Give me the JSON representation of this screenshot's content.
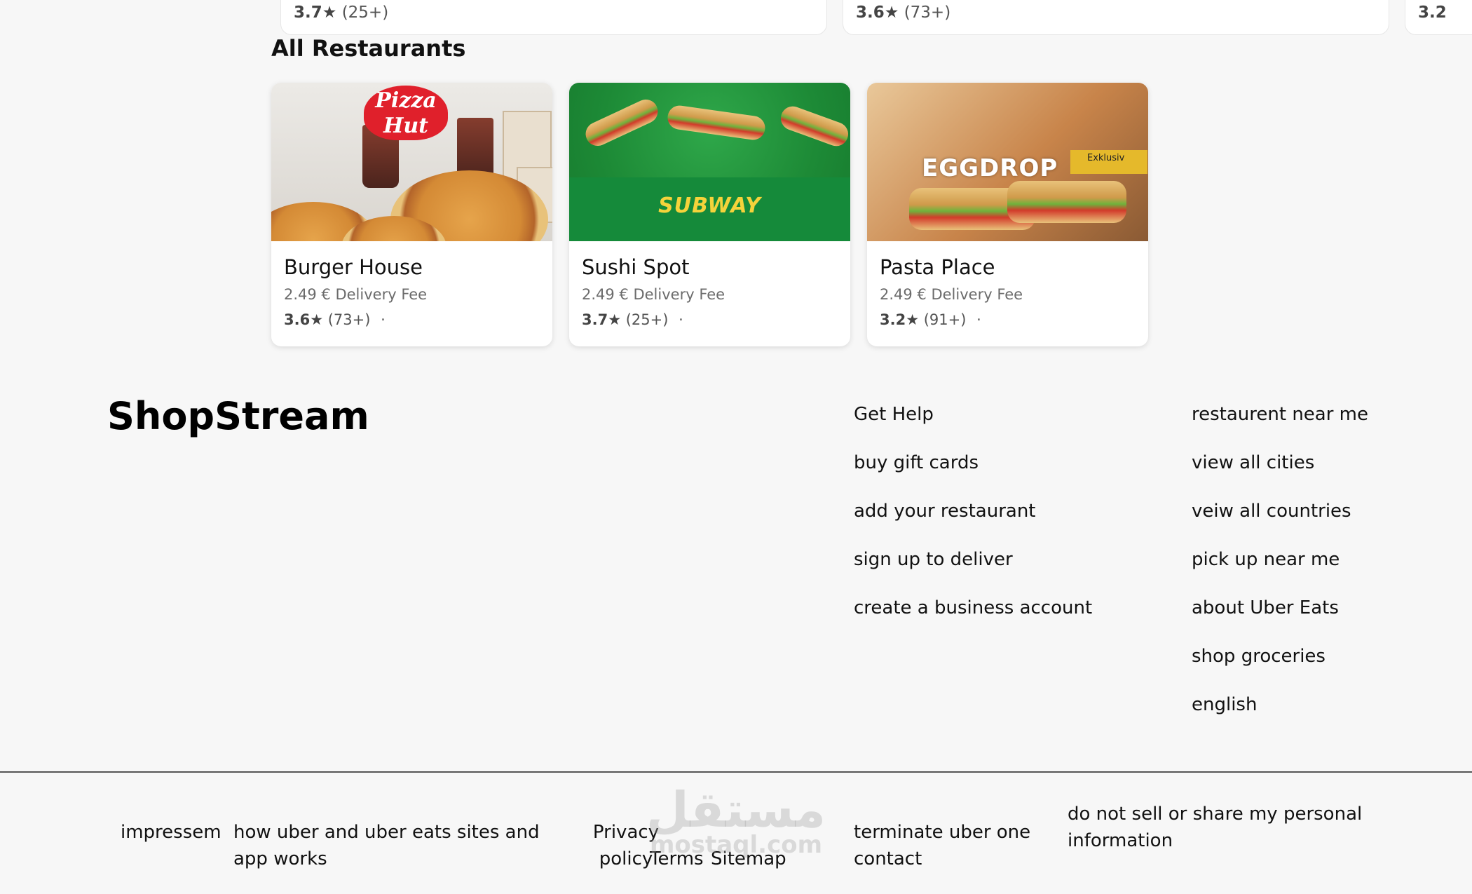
{
  "top_carousel": [
    {
      "rating": "3.7★",
      "count": "(25+)"
    },
    {
      "rating": "3.6★",
      "count": "(73+)"
    },
    {
      "rating": "3.2"
    }
  ],
  "section_title": "All Restaurants",
  "restaurants": [
    {
      "name": "Burger House",
      "fee": "2.49 € Delivery Fee",
      "rating": "3.6★",
      "count": "(73+)",
      "dot": "·",
      "image_logo": "Pizza Hut"
    },
    {
      "name": "Sushi Spot",
      "fee": "2.49 € Delivery Fee",
      "rating": "3.7★",
      "count": "(25+)",
      "dot": "·",
      "image_logo": "SUBWAY"
    },
    {
      "name": "Pasta Place",
      "fee": "2.49 € Delivery Fee",
      "rating": "3.2★",
      "count": "(91+)",
      "dot": "·",
      "image_logo": "EGGDROP",
      "image_badge": "Exklusiv"
    }
  ],
  "footer": {
    "brand": "ShopStream",
    "col1": [
      "Get Help",
      "buy gift cards",
      "add your restaurant",
      "sign up to deliver",
      "create a business account"
    ],
    "col2": [
      "restaurent near me",
      "view all cities",
      "veiw all countries",
      "pick up near me",
      "about Uber Eats",
      "shop groceries",
      "english"
    ]
  },
  "bottom_links": {
    "impressem": "impressem",
    "how_it_works": "how uber and uber eats sites and app works",
    "privacy": "Privacy policy",
    "terms": "Terms",
    "sitemap": "Sitemap",
    "terminate": "terminate uber one",
    "contact": "contact",
    "do_not_sell": "do not sell or share my personal information"
  },
  "watermark": {
    "line1": "مستقل",
    "line2": "mostaql.com"
  }
}
